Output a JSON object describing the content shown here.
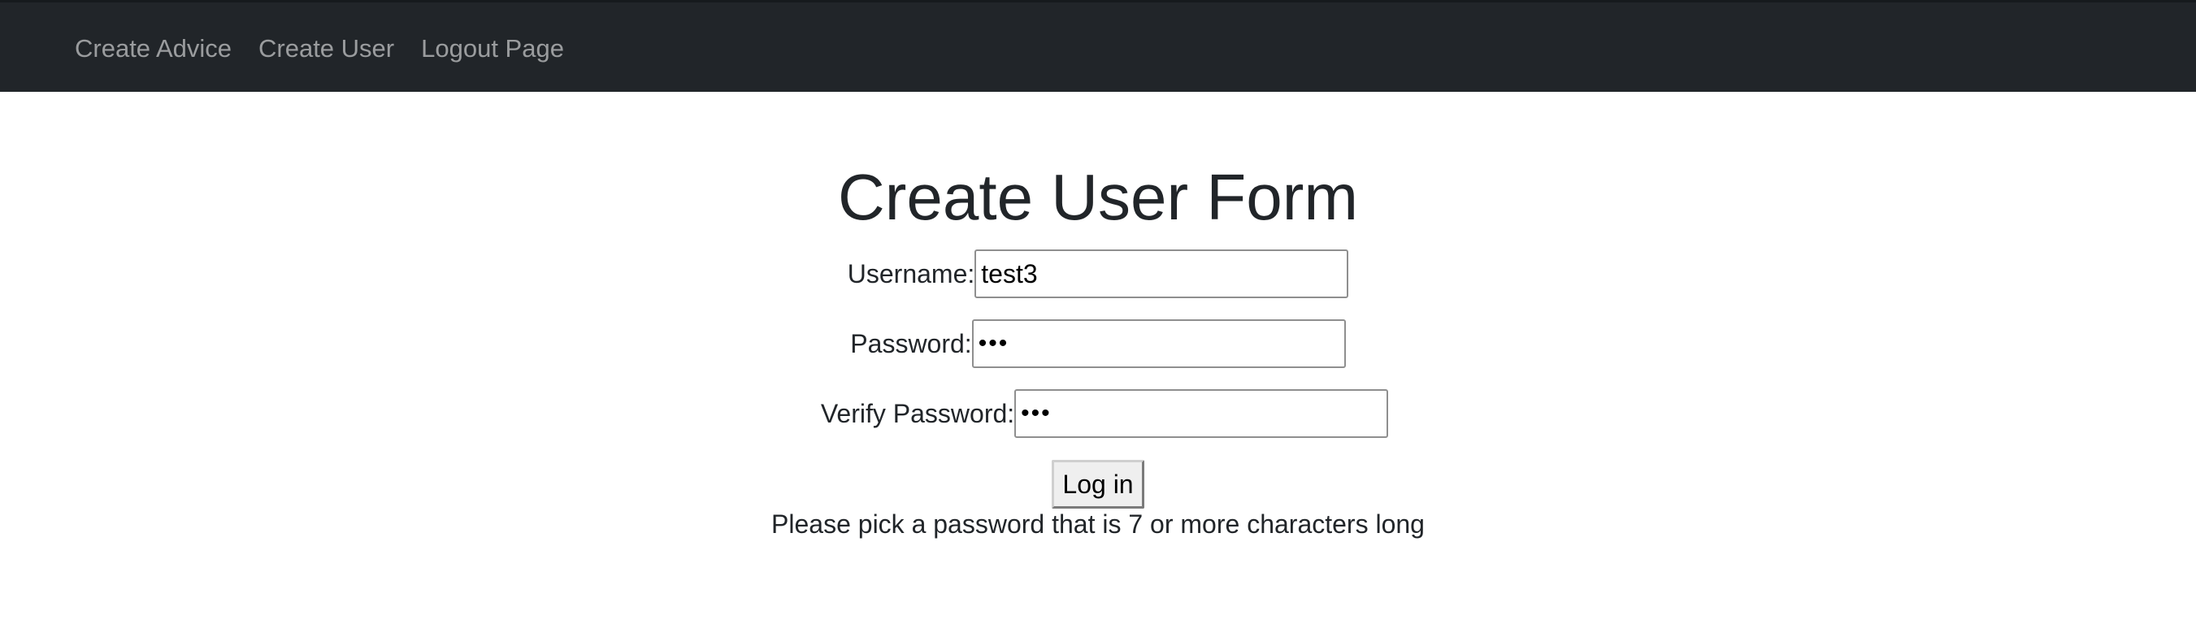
{
  "nav": {
    "links": [
      "Create Advice",
      "Create User",
      "Logout Page"
    ]
  },
  "form": {
    "title": "Create User Form",
    "username_label": "Username:",
    "username_value": "test3",
    "password_label": "Password:",
    "password_value": "abc",
    "verify_label": "Verify Password:",
    "verify_value": "abc",
    "submit_label": "Log in",
    "hint": "Please pick a password that is 7 or more characters long"
  },
  "colors": {
    "navbar_bg": "#212529",
    "nav_link": "rgba(255,255,255,0.55)",
    "text": "#212529"
  }
}
